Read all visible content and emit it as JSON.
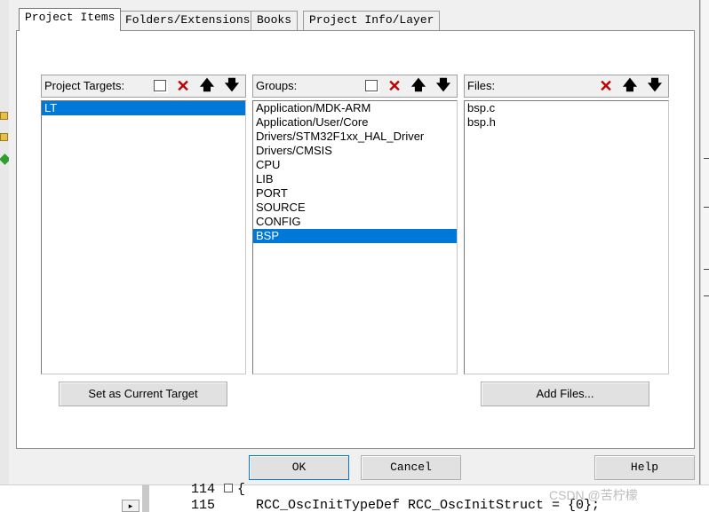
{
  "dialog": {
    "tabs": [
      {
        "label": "Project Items",
        "active": true
      },
      {
        "label": "Folders/Extensions",
        "active": false
      },
      {
        "label": "Books",
        "active": false
      },
      {
        "label": "Project Info/Layer",
        "active": false
      }
    ]
  },
  "targets": {
    "header": "Project Targets:",
    "items": [
      "LT"
    ],
    "selected_index": 0,
    "set_current_label": "Set as Current Target"
  },
  "groups": {
    "header": "Groups:",
    "items": [
      "Application/MDK-ARM",
      "Application/User/Core",
      "Drivers/STM32F1xx_HAL_Driver",
      "Drivers/CMSIS",
      "CPU",
      "LIB",
      "PORT",
      "SOURCE",
      "CONFIG",
      "BSP"
    ],
    "selected_index": 9
  },
  "files": {
    "header": "Files:",
    "items": [
      "bsp.c",
      "bsp.h"
    ],
    "add_files_label": "Add Files..."
  },
  "footer": {
    "ok_label": "OK",
    "cancel_label": "Cancel",
    "help_label": "Help"
  },
  "background_editor": {
    "line_numbers": [
      "114",
      "115"
    ],
    "line_114_code": "{",
    "line_115_code": "RCC_OscInitTypeDef RCC_OscInitStruct = {0};",
    "scroll_arrow": "▸"
  },
  "icons": {
    "new": "new-item-icon",
    "delete": "delete-icon",
    "move_up": "move-up-icon",
    "move_down": "move-down-icon"
  },
  "colors": {
    "selection": "#0078d7",
    "delete_red": "#c00000",
    "dialog_bg": "#f0f0f0"
  },
  "watermark": "CSDN @苦柠檬"
}
